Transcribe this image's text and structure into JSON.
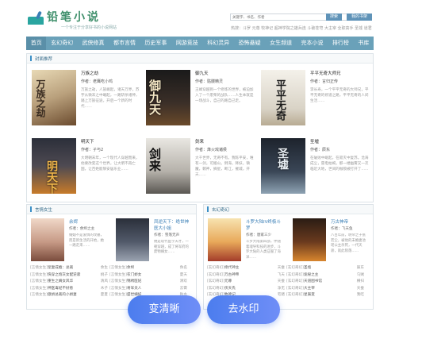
{
  "site": {
    "name": "铅笔小说",
    "slogan": "一个专注于分享好书的小说网站",
    "search_placeholder": "关键字、书名、作者",
    "search_label": "搜索",
    "shelf_label": "我的书架",
    "hot_label": "热搜：",
    "hot_terms": "斗罗 元尊 牧神记 超神学院之雄兵连 斗破苍穹 大主宰 全职高手 圣墟 道君"
  },
  "nav": [
    "首页",
    "玄幻奇幻",
    "武侠修真",
    "都市言情",
    "历史军事",
    "网游竞技",
    "科幻灵异",
    "恐怖悬疑",
    "女生频道",
    "完本小说",
    "排行榜",
    "书库"
  ],
  "featured": {
    "title": "封面推荐",
    "books": [
      {
        "name": "万族之劫",
        "author": "作者：老鹰吃小鸡",
        "desc": "万族之劫，人族崛起，诸天万界，苏宇从微末之中崛起，一路斩杀诸神，踏上万族征途，开启一个新的时代……"
      },
      {
        "name": "御九天",
        "author": "作者：骷髅精灵",
        "desc": "王峰穿越到一个修炼的世界，被迫加入了一个废柴的战队……人生本就是一场战斗，自己的路自己走。"
      },
      {
        "name": "平平无奇大师兄",
        "author": "作者：言归正传",
        "desc": "李长寿，一个平平无奇的大师兄，平平无奇的修道之路，平平无奇的人间生活……"
      },
      {
        "name": "明天下",
        "author": "作者：孑与2",
        "desc": "大明朝末年，一个现代人穿越而来，他要改变这个世界，让大明不再亡国，让百姓能够安居乐业……"
      },
      {
        "name": "剑来",
        "author": "作者：烽火戏诸侯",
        "desc": "大千世界，无奇不有。我陈平安，唯有一剑，可搬山，倒海，降妖，镇魔，敕神，摘星，断江，摧城，开天……"
      },
      {
        "name": "圣墟",
        "author": "作者：辰东",
        "desc": "在破败中崛起，在寂灭中复苏。沧海成尘，雷电枯竭，那一缕幽雾又一次临近大地，世间的枷锁被打开了……"
      }
    ]
  },
  "section_left": {
    "title": "言情女生",
    "cards": [
      {
        "name": "余烬",
        "author": "作者：余烬之主",
        "desc": "婚姻不是爱情的坟墓，而是新生活的开始，她一路走来……"
      },
      {
        "name": "凤逆天下：绝世神医大小姐",
        "author": "作者：雪落无声",
        "desc": "她是现代医学天才，一朝穿越，成了将军府的废物嫡女……"
      }
    ],
    "rows": [
      {
        "tag": "[言情女生]",
        "name": "宠妻成瘾：总裁",
        "author": "余生"
      },
      {
        "tag": "[言情女生]",
        "name": "快穿之炮灰女配逆袭",
        "author": "桃子"
      },
      {
        "tag": "[言情女生]",
        "name": "重生之嫡女风华",
        "author": "清风"
      },
      {
        "tag": "[言情女生]",
        "name": "神医毒妃不好惹",
        "author": "木子"
      },
      {
        "tag": "[言情女生]",
        "name": "傲娇总裁的小娇妻",
        "author": "夏夏"
      }
    ],
    "rows2": [
      {
        "tag": "[言情女生]",
        "name": "余烬",
        "author": "佚名"
      },
      {
        "tag": "[言情女生]",
        "name": "农门娇女",
        "author": "夏天"
      },
      {
        "tag": "[言情女生]",
        "name": "锦绣医妃",
        "author": "清欢"
      },
      {
        "tag": "[言情女生]",
        "name": "将军夫人",
        "author": "云霄"
      },
      {
        "tag": "[言情女生]",
        "name": "盛世嫡妃",
        "author": "秋水"
      }
    ]
  },
  "section_right": {
    "title": "玄幻奇幻",
    "cards": [
      {
        "name": "斗罗大陆IV终极斗罗",
        "author": "作者：唐家三少",
        "desc": "斗罗大陆第四部，伴随着魂导科技的进步，斗罗大陆的人类征服了海洋……"
      },
      {
        "name": "万古神帝",
        "author": "作者：飞天鱼",
        "desc": "八百年前，明帝之子张若尘，被他的未婚妻池瑶公主杀死，一代天骄，就此陨落……"
      }
    ],
    "rows": [
      {
        "tag": "[玄幻奇幻]",
        "name": "绝代神主",
        "author": "天蚕"
      },
      {
        "tag": "[玄幻奇幻]",
        "name": "万古神帝",
        "author": "飞天"
      },
      {
        "tag": "[玄幻奇幻]",
        "name": "元尊",
        "author": "天蚕"
      },
      {
        "tag": "[玄幻奇幻]",
        "name": "伏天氏",
        "author": "净无"
      },
      {
        "tag": "[玄幻奇幻]",
        "name": "牧神记",
        "author": "宅猪"
      }
    ],
    "rows2": [
      {
        "tag": "[玄幻奇幻]",
        "name": "圣墟",
        "author": "辰东"
      },
      {
        "tag": "[玄幻奇幻]",
        "name": "诡秘之主",
        "author": "乌贼"
      },
      {
        "tag": "[玄幻奇幻]",
        "name": "天道图书馆",
        "author": "横扫"
      },
      {
        "tag": "[玄幻奇幻]",
        "name": "大主宰",
        "author": "天蚕"
      },
      {
        "tag": "[玄幻奇幻]",
        "name": "星辰变",
        "author": "我吃"
      }
    ]
  },
  "overlay": {
    "clarify_label": "变清晰",
    "watermark_label": "去水印"
  }
}
